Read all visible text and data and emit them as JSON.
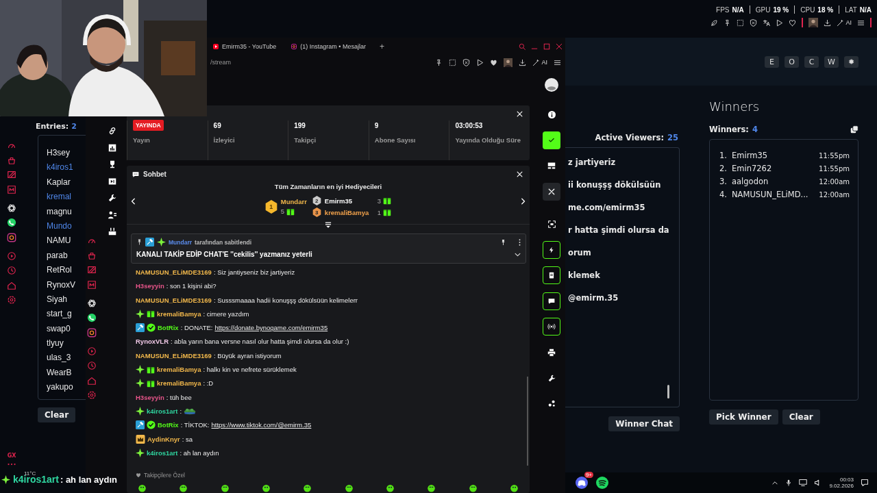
{
  "overlay_stats": [
    {
      "label": "FPS",
      "value": "N/A"
    },
    {
      "label": "GPU",
      "value": "19 %"
    },
    {
      "label": "CPU",
      "value": "18 %"
    },
    {
      "label": "LAT",
      "value": "N/A"
    }
  ],
  "overlay_toolbar": {
    "ai_label": "AI"
  },
  "os_sidebar": {
    "logo": "GX"
  },
  "giveaway": {
    "mode_buttons": [
      "E",
      "O",
      "C",
      "W",
      "✹"
    ],
    "entries": {
      "label": "Entries:",
      "count": "2",
      "clear_button": "Clear",
      "items": [
        {
          "name": "H3sey",
          "color": "#e8e8e8"
        },
        {
          "name": "k4iros1",
          "color": "#4f86e8"
        },
        {
          "name": "Kaplar",
          "color": "#e8e8e8"
        },
        {
          "name": "kremal",
          "color": "#4f86e8"
        },
        {
          "name": "magnu",
          "color": "#e8e8e8"
        },
        {
          "name": "Mundo",
          "color": "#4f86e8"
        },
        {
          "name": "NAMU",
          "color": "#e8e8e8"
        },
        {
          "name": "parab",
          "color": "#e8e8e8"
        },
        {
          "name": "RetRol",
          "color": "#e8e8e8"
        },
        {
          "name": "RynoxV",
          "color": "#e8e8e8"
        },
        {
          "name": "Siyah",
          "color": "#e8e8e8"
        },
        {
          "name": "start_g",
          "color": "#e8e8e8"
        },
        {
          "name": "swap0",
          "color": "#e8e8e8"
        },
        {
          "name": "tlyuy",
          "color": "#e8e8e8"
        },
        {
          "name": "ulas_3",
          "color": "#e8e8e8"
        },
        {
          "name": "WearB",
          "color": "#e8e8e8"
        },
        {
          "name": "yakupo",
          "color": "#e8e8e8"
        }
      ]
    },
    "viewers": {
      "label": "Active Viewers:",
      "count": "25",
      "button": "Winner Chat",
      "lines": [
        "z jartiyeriz",
        "ii konuşşş dökülsüün",
        "me.com/emirm35",
        "r hatta şimdi olursa da",
        "orum",
        "klemek",
        "@emirm.35"
      ]
    },
    "winners": {
      "title": "Winners",
      "label": "Winners:",
      "count": "4",
      "buttons": [
        "Pick Winner",
        "Clear"
      ],
      "items": [
        {
          "rank": "1.",
          "name": "Emirm35",
          "time": "11:55pm"
        },
        {
          "rank": "2.",
          "name": "Emin7262",
          "time": "11:55pm"
        },
        {
          "rank": "3.",
          "name": "aalgodon",
          "time": "12:00am"
        },
        {
          "rank": "4.",
          "name": "NAMUSUN_ELiMD...",
          "time": "12:00am"
        }
      ]
    }
  },
  "browser": {
    "tabs": [
      {
        "title": "Emirm35 - YouTube"
      },
      {
        "title": "(1) Instagram • Mesajlar"
      }
    ],
    "new_tab": "+",
    "url": "/stream",
    "ai_label": "AI"
  },
  "stats": [
    {
      "kind": "live",
      "badge": "YAYINDA",
      "label": "Yayın"
    },
    {
      "kind": "number",
      "value": "69",
      "label": "İzleyici"
    },
    {
      "kind": "number",
      "value": "199",
      "label": "Takipçi"
    },
    {
      "kind": "number",
      "value": "9",
      "label": "Abone Sayısı"
    },
    {
      "kind": "number",
      "value": "03:00:53",
      "label": "Yayında Olduğu Süre"
    }
  ],
  "chat": {
    "title": "Sohbet",
    "gifters_title": "Tüm Zamanların en iyi Hediyecileri",
    "gifters": [
      {
        "rank": "1",
        "name": "Mundarr",
        "count": "5"
      },
      {
        "rank": "2",
        "name": "Emirm35",
        "count": "3"
      },
      {
        "rank": "3",
        "name": "kremaliBamya",
        "count": "1"
      }
    ],
    "pinned": {
      "moderator": true,
      "sparkle": true,
      "by": "Mundarr",
      "by_suffix": "tarafından sabitlendi",
      "text": "KANALI TAKİP EDİP CHAT'E ''cekilis'' yazmanız yeterli"
    },
    "messages": [
      {
        "user": "NAMUSUN_ELiMDE3169",
        "color": "#f2b84b",
        "text": ": Siz jantiyseniz biz jartiyeriz"
      },
      {
        "user": "H3seyyin",
        "color": "#e8558a",
        "text": ": son 1 kişini abi?"
      },
      {
        "user": "NAMUSUN_ELiMDE3169",
        "color": "#f2b84b",
        "text": ": Susssmaaaa hadii konuşşş dökülsüün kelimelerr"
      },
      {
        "user": "kremaliBamya",
        "color": "#f2b84b",
        "sparkle": true,
        "gift": true,
        "text": ": cimere yazdım"
      },
      {
        "user": "BotRix",
        "color": "#53fc18",
        "moderator": true,
        "verified": true,
        "text": ": DONATE:",
        "link": "https://donate.bynogame.com/emirm35"
      },
      {
        "user": "RynoxVLR",
        "color": "#f0c8e6",
        "text": ": abla yarın bana versne nasıl olur hatta şimdi olursa da olur :)"
      },
      {
        "user": "NAMUSUN_ELiMDE3169",
        "color": "#f2b84b",
        "text": ": Büyük ayran istiyorum"
      },
      {
        "user": "kremaliBamya",
        "color": "#f2b84b",
        "sparkle": true,
        "gift": true,
        "text": ": halkı kin ve nefrete sürüklemek"
      },
      {
        "user": "kremaliBamya",
        "color": "#f2b84b",
        "sparkle": true,
        "gift": true,
        "text": ": :D"
      },
      {
        "user": "H3seyyin",
        "color": "#e8558a",
        "text": ": tüh bee"
      },
      {
        "user": "k4iros1art",
        "color": "#2fd6a0",
        "sparkle": true,
        "text": ":",
        "kind": "emote"
      },
      {
        "user": "BotRix",
        "color": "#53fc18",
        "moderator": true,
        "verified": true,
        "text": ": TİKTOK:",
        "link": "https://www.tiktok.com/@emirm.35"
      },
      {
        "user": "AydinKnyr",
        "color": "#f2b84b",
        "crown": true,
        "text": ": sa"
      },
      {
        "user": "k4iros1art",
        "color": "#2fd6a0",
        "sparkle": true,
        "text": ": ah lan aydın"
      }
    ],
    "footer": "Takipçilere Özel"
  },
  "taskbar": {
    "discord_badge": "9+",
    "time": "00:03",
    "date": "9.02.2026"
  },
  "caption": {
    "weather": "11°C",
    "user": "k4iros1art",
    "text": ": ah lan aydın"
  }
}
